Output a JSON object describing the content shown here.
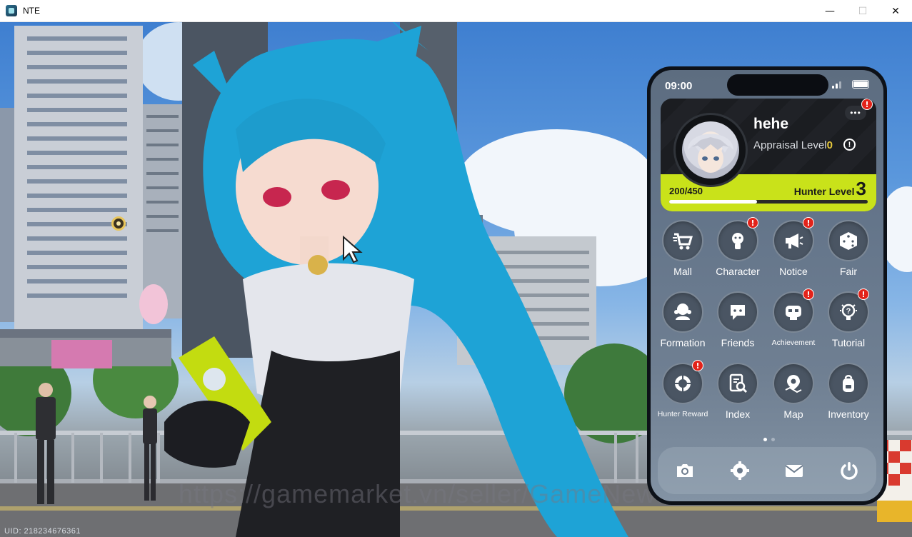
{
  "window": {
    "title": "NTE",
    "buttons": {
      "minimize": "—",
      "maximize": "☐",
      "close": "✕"
    }
  },
  "game": {
    "uid": "UID: 218234676361",
    "watermark": "https://gamemarket.vn/seller/GameNews"
  },
  "phone": {
    "status_time": "09:00",
    "profile": {
      "username": "hehe",
      "appraisal_label": "Appraisal Level",
      "appraisal_level": "0",
      "exp_text": "200/450",
      "exp_fraction": 0.444,
      "hunter_level_label": "Hunter Level",
      "hunter_level": "3",
      "more_badge": "!",
      "accent_color": "#c9e21a"
    },
    "apps": [
      {
        "label": "Mall",
        "icon": "cart-icon",
        "badge": false
      },
      {
        "label": "Character",
        "icon": "character-icon",
        "badge": true
      },
      {
        "label": "Notice",
        "icon": "megaphone-icon",
        "badge": true
      },
      {
        "label": "Fair",
        "icon": "dice-icon",
        "badge": false
      },
      {
        "label": "Formation",
        "icon": "formation-icon",
        "badge": false
      },
      {
        "label": "Friends",
        "icon": "chat-icon",
        "badge": false
      },
      {
        "label": "Achievement",
        "icon": "achievement-icon",
        "badge": true
      },
      {
        "label": "Tutorial",
        "icon": "bulb-icon",
        "badge": true
      },
      {
        "label": "Hunter Reward",
        "icon": "crosshair-icon",
        "badge": true
      },
      {
        "label": "Index",
        "icon": "index-icon",
        "badge": false
      },
      {
        "label": "Map",
        "icon": "map-pin-icon",
        "badge": false
      },
      {
        "label": "Inventory",
        "icon": "backpack-icon",
        "badge": false
      }
    ],
    "badge_text": "!",
    "pager": {
      "pages": 2,
      "current": 1
    },
    "dock": [
      "camera-icon",
      "settings-icon",
      "mail-icon",
      "power-icon"
    ]
  }
}
